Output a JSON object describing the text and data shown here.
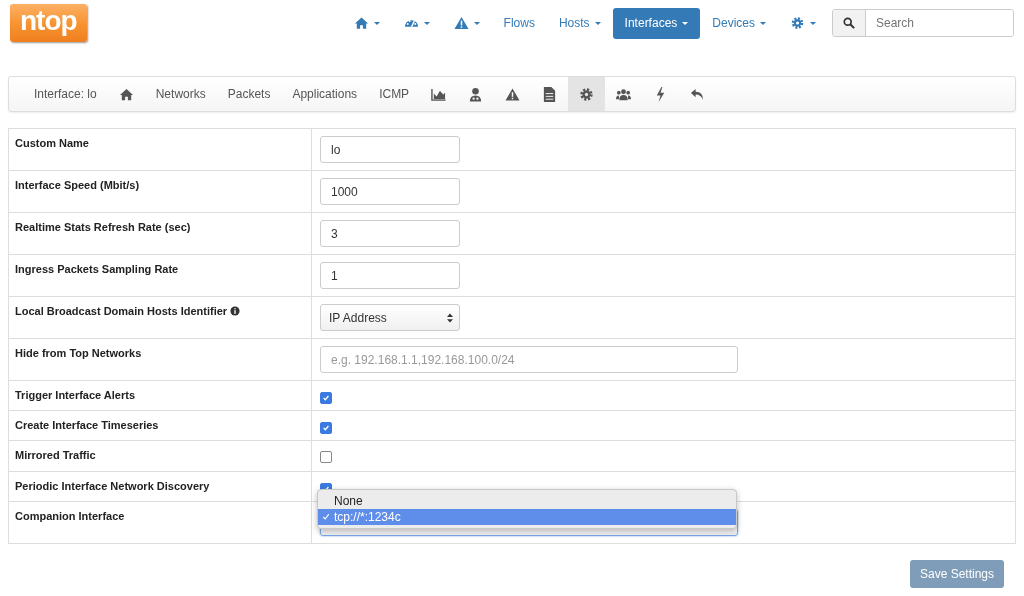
{
  "logo": "ntop",
  "nav": [
    {
      "kind": "home",
      "dropdown": true,
      "selected": false
    },
    {
      "kind": "gauge",
      "dropdown": true,
      "selected": false
    },
    {
      "kind": "warning",
      "dropdown": true,
      "selected": false
    },
    {
      "kind": "text",
      "label": "Flows",
      "dropdown": false,
      "selected": false
    },
    {
      "kind": "text",
      "label": "Hosts",
      "dropdown": true,
      "selected": false
    },
    {
      "kind": "text",
      "label": "Interfaces",
      "dropdown": true,
      "selected": true
    },
    {
      "kind": "text",
      "label": "Devices",
      "dropdown": true,
      "selected": false
    },
    {
      "kind": "gear",
      "dropdown": true,
      "selected": false
    }
  ],
  "search": {
    "placeholder": "Search"
  },
  "subnav": [
    {
      "kind": "text",
      "label": "Interface: lo",
      "selected": false
    },
    {
      "kind": "home",
      "selected": false
    },
    {
      "kind": "text",
      "label": "Networks",
      "selected": false
    },
    {
      "kind": "text",
      "label": "Packets",
      "selected": false
    },
    {
      "kind": "text",
      "label": "Applications",
      "selected": false
    },
    {
      "kind": "text",
      "label": "ICMP",
      "selected": false
    },
    {
      "kind": "area-chart",
      "selected": false
    },
    {
      "kind": "user",
      "selected": false
    },
    {
      "kind": "warning",
      "selected": false
    },
    {
      "kind": "document",
      "selected": false
    },
    {
      "kind": "gear",
      "selected": true
    },
    {
      "kind": "group",
      "selected": false
    },
    {
      "kind": "bolt",
      "selected": false
    },
    {
      "kind": "reply-arrow",
      "selected": false
    }
  ],
  "settings": [
    {
      "kind": "input",
      "label": "Custom Name",
      "value": "lo"
    },
    {
      "kind": "input",
      "label": "Interface Speed (Mbit/s)",
      "value": "1000"
    },
    {
      "kind": "input",
      "label": "Realtime Stats Refresh Rate (sec)",
      "value": "3"
    },
    {
      "kind": "input",
      "label": "Ingress Packets Sampling Rate",
      "value": "1"
    },
    {
      "kind": "select",
      "label": "Local Broadcast Domain Hosts Identifier",
      "info": true,
      "value": "IP Address"
    },
    {
      "kind": "wide_input",
      "label": "Hide from Top Networks",
      "placeholder": "e.g. 192.168.1.1,192.168.100.0/24"
    },
    {
      "kind": "checkbox",
      "label": "Trigger Interface Alerts",
      "checked": true
    },
    {
      "kind": "checkbox",
      "label": "Create Interface Timeseries",
      "checked": true
    },
    {
      "kind": "checkbox",
      "label": "Mirrored Traffic",
      "checked": false
    },
    {
      "kind": "checkbox",
      "label": "Periodic Interface Network Discovery",
      "checked": true
    },
    {
      "kind": "open_select",
      "label": "Companion Interface",
      "options": [
        {
          "label": "None",
          "selected": false
        },
        {
          "label": "tcp://*:1234c",
          "selected": true
        }
      ]
    }
  ],
  "save_button": "Save Settings"
}
